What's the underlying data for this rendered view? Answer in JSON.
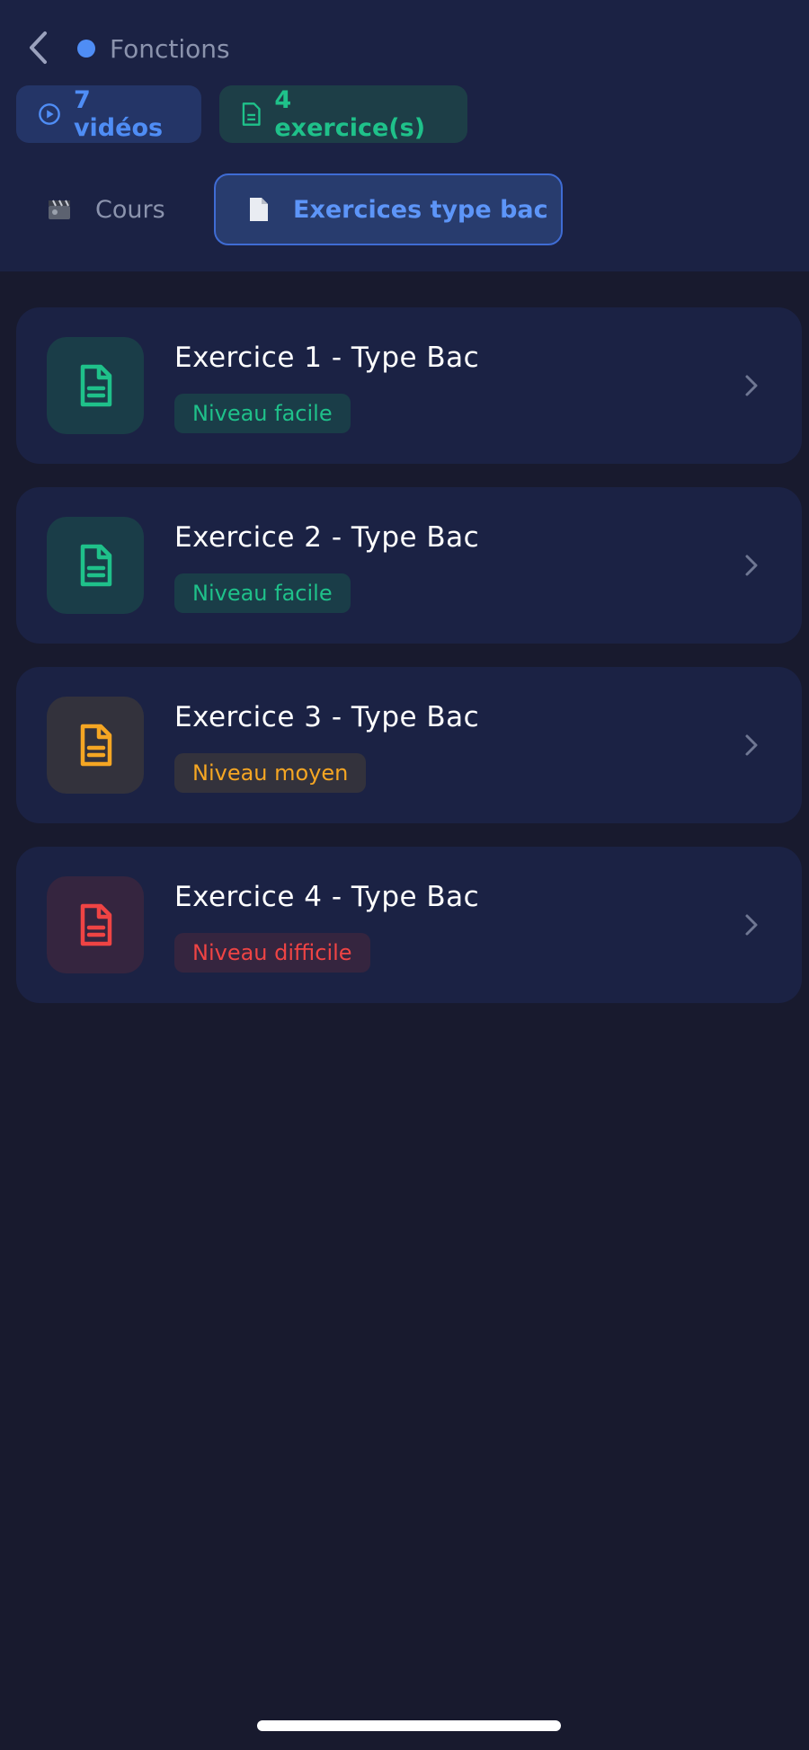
{
  "header": {
    "topic": "Fonctions",
    "topic_dot_color": "#4f8df5",
    "badges": {
      "videos": "7 vidéos",
      "exercises": "4 exercice(s)"
    },
    "tabs": [
      {
        "label": "Cours",
        "icon": "clapper-icon",
        "active": false
      },
      {
        "label": "Exercices type bac",
        "icon": "document-icon",
        "active": true
      }
    ]
  },
  "exercises": [
    {
      "title": "Exercice 1 - Type Bac",
      "level": "Niveau facile",
      "color": "#1fc18a",
      "bg": "#1a3d48",
      "level_bg": "#1a3d48"
    },
    {
      "title": "Exercice 2 - Type Bac",
      "level": "Niveau facile",
      "color": "#1fc18a",
      "bg": "#1a3d48",
      "level_bg": "#1a3d48"
    },
    {
      "title": "Exercice 3 - Type Bac",
      "level": "Niveau moyen",
      "color": "#f5a623",
      "bg": "#33323c",
      "level_bg": "#33323c"
    },
    {
      "title": "Exercice 4 - Type Bac",
      "level": "Niveau difficile",
      "color": "#ef4444",
      "bg": "#35253f",
      "level_bg": "#35253f"
    }
  ],
  "colors": {
    "background": "#181a2e",
    "surface": "#1b2244",
    "accent": "#4f8df5",
    "muted": "#8b93ad"
  }
}
